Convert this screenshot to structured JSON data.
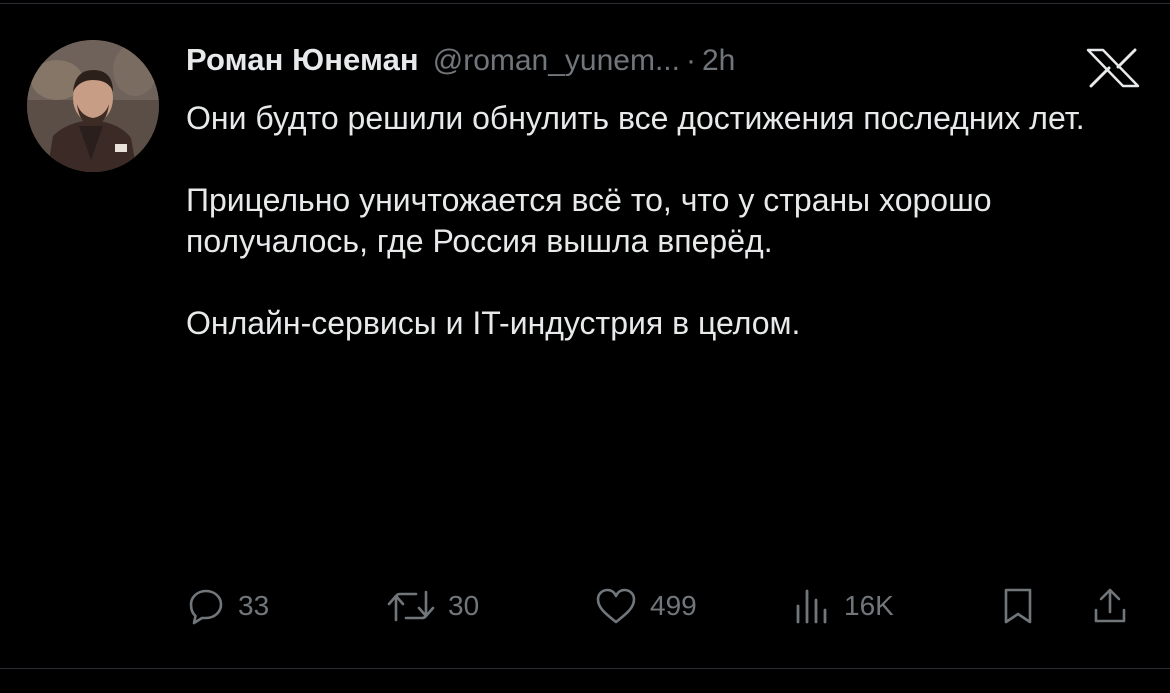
{
  "tweet": {
    "author": {
      "display_name": "Роман Юнеман",
      "handle": "@roman_yunem...",
      "separator": "·",
      "time": "2h"
    },
    "text": [
      "Они будто решили обнулить все достижения последних лет.",
      "Прицельно уничтожается всё то, что у страны хорошо получалось, где Россия вышла вперёд.",
      "Онлайн-сервисы и IT-индустрия в целом."
    ],
    "actions": {
      "replies": "33",
      "reposts": "30",
      "likes": "499",
      "views": "16K"
    }
  },
  "icons": {
    "platform": "x-logo-icon",
    "reply": "reply-icon",
    "repost": "repost-icon",
    "like": "heart-icon",
    "views": "views-chart-icon",
    "bookmark": "bookmark-icon",
    "share": "share-icon"
  },
  "colors": {
    "background": "#000000",
    "text": "#e7e9ea",
    "secondary": "#71767b"
  }
}
